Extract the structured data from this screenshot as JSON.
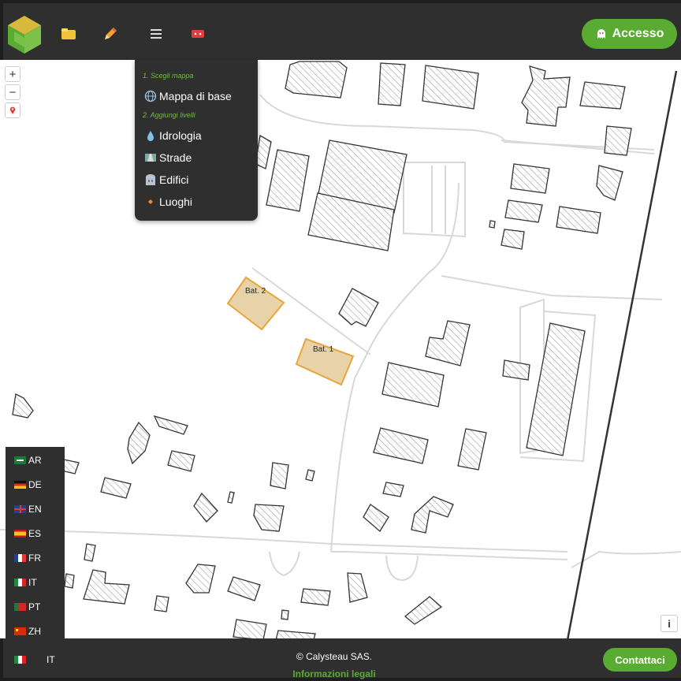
{
  "header": {
    "login_label": "Accesso",
    "tools": [
      {
        "name": "folder-icon"
      },
      {
        "name": "pencil-icon"
      },
      {
        "name": "menu-icon"
      },
      {
        "name": "ticket-icon"
      }
    ]
  },
  "layers_menu": {
    "step1": "1. Scegli mappa",
    "base_map": "Mappa di base",
    "step2": "2. Aggiungi livelli",
    "layers": [
      "Idrologia",
      "Strade",
      "Edifici",
      "Luoghi"
    ]
  },
  "map": {
    "zoom_in": "+",
    "zoom_out": "−",
    "buildings": [
      {
        "label": "Bat. 2"
      },
      {
        "label": "Bat. 1"
      }
    ],
    "info": "i"
  },
  "languages": [
    "AR",
    "DE",
    "EN",
    "ES",
    "FR",
    "IT",
    "PT",
    "ZH"
  ],
  "footer": {
    "current_lang": "IT",
    "copyright": "© Calysteau SAS.",
    "legal": "Informazioni legali",
    "contact": "Contattaci"
  },
  "colors": {
    "accent": "#5aab32",
    "panel": "#2f2f2f",
    "selected_building_fill": "#e8d3a8",
    "selected_building_stroke": "#e8a53a"
  }
}
